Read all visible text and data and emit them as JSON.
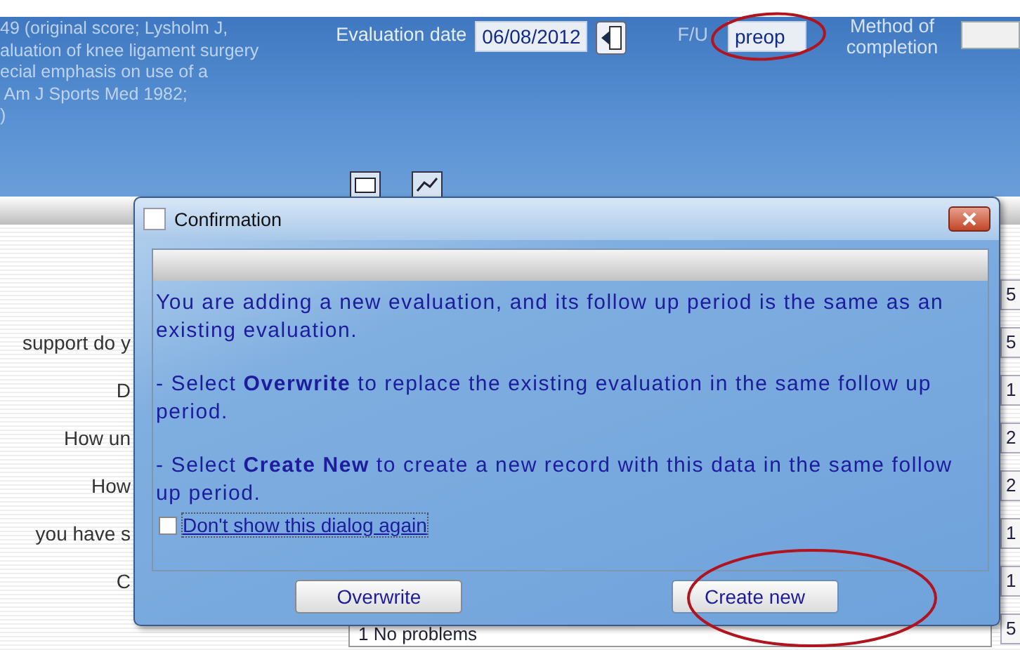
{
  "citation_lines": [
    "49 (original score; Lysholm J,",
    "aluation of knee ligament surgery",
    "ecial emphasis on use of a",
    " Am J Sports Med 1982;",
    ")"
  ],
  "evaluation_date": {
    "label": "Evaluation date",
    "value": "06/08/2012"
  },
  "follow_up": {
    "label": "F/U",
    "value": "preop"
  },
  "method_of_completion": {
    "label": "Method of completion"
  },
  "questions": [
    {
      "value": "5"
    },
    {
      "label": "support do y",
      "value": "5"
    },
    {
      "label": "D",
      "value": "1"
    },
    {
      "label": "How un",
      "value": "2"
    },
    {
      "label": "How",
      "value": "2"
    },
    {
      "label": "you have s",
      "value": "1"
    },
    {
      "label": "C",
      "value": "1"
    },
    {
      "answer": "1 No problems",
      "value": "5"
    }
  ],
  "dialog": {
    "title": "Confirmation",
    "paragraphs": [
      "You are adding a new evaluation, and its follow up period is the same as an existing evaluation.",
      "- Select  **Overwrite**  to replace the existing evaluation in the same follow up period.",
      "- Select  **Create New**  to create a new record with this data in the same follow up period."
    ],
    "checkbox": {
      "label": "Don't show this dialog again",
      "checked": false
    },
    "buttons": [
      {
        "label": "Overwrite",
        "highlighted": false
      },
      {
        "label": "Create new",
        "highlighted": true
      }
    ]
  },
  "follow_up_highlighted": true
}
